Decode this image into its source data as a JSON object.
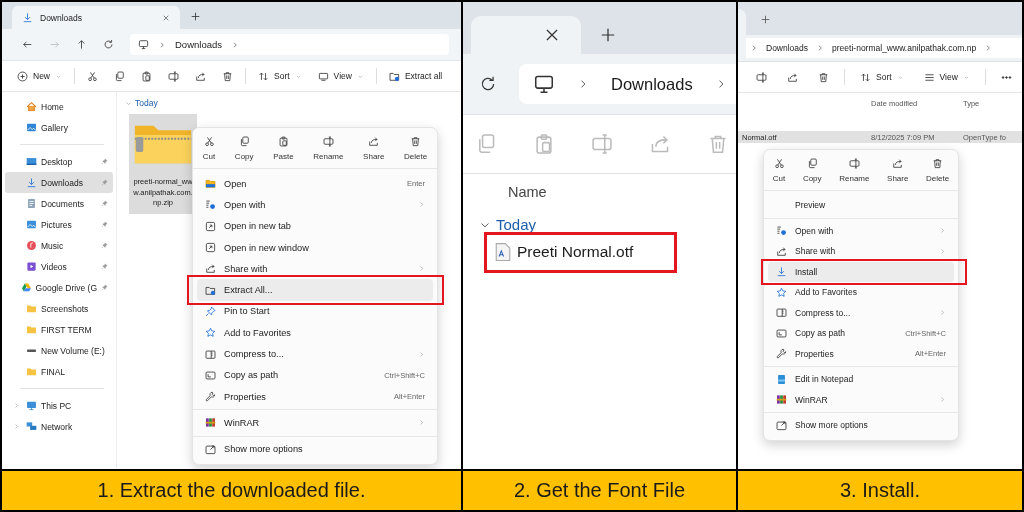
{
  "step1": {
    "tab": {
      "title": "Downloads"
    },
    "nav": [
      {
        "kind": "back",
        "disabled": false
      },
      {
        "kind": "forward",
        "disabled": true
      },
      {
        "kind": "up",
        "disabled": false
      },
      {
        "kind": "refresh",
        "disabled": false
      }
    ],
    "computer_root": true,
    "path": [
      "Downloads"
    ],
    "toolbar": [
      [
        {
          "kind": "new",
          "label": "New",
          "dropdown": true
        }
      ],
      [
        {
          "kind": "cut"
        },
        {
          "kind": "copy"
        },
        {
          "kind": "paste"
        },
        {
          "kind": "rename"
        },
        {
          "kind": "share"
        },
        {
          "kind": "delete"
        }
      ],
      [
        {
          "kind": "sort",
          "label": "Sort",
          "dropdown": true
        },
        {
          "kind": "view",
          "label": "View",
          "dropdown": true
        }
      ],
      [
        {
          "kind": "extract",
          "label": "Extract all",
          "dropdown": false
        }
      ]
    ],
    "sidebar": [
      {
        "items": [
          {
            "kind": "home",
            "label": "Home",
            "pinned": false,
            "selected": false,
            "expandable": false
          },
          {
            "kind": "gallery",
            "label": "Gallery",
            "pinned": false,
            "selected": false,
            "expandable": false
          }
        ]
      },
      {
        "items": [
          {
            "kind": "desktop",
            "label": "Desktop",
            "pinned": true,
            "selected": false,
            "expandable": false
          },
          {
            "kind": "downloads",
            "label": "Downloads",
            "pinned": true,
            "selected": true,
            "expandable": false
          },
          {
            "kind": "documents",
            "label": "Documents",
            "pinned": true,
            "selected": false,
            "expandable": false
          },
          {
            "kind": "pictures",
            "label": "Pictures",
            "pinned": true,
            "selected": false,
            "expandable": false
          },
          {
            "kind": "music",
            "label": "Music",
            "pinned": true,
            "selected": false,
            "expandable": false
          },
          {
            "kind": "videos",
            "label": "Videos",
            "pinned": true,
            "selected": false,
            "expandable": false
          },
          {
            "kind": "gdrive",
            "label": "Google Drive (G",
            "pinned": true,
            "selected": false,
            "expandable": false
          },
          {
            "kind": "folder",
            "label": "Screenshots",
            "pinned": false,
            "selected": false,
            "expandable": false
          },
          {
            "kind": "folder",
            "label": "FIRST TERM",
            "pinned": false,
            "selected": false,
            "expandable": false
          },
          {
            "kind": "drive",
            "label": "New Volume (E:)",
            "pinned": false,
            "selected": false,
            "expandable": false
          },
          {
            "kind": "folder",
            "label": "FINAL",
            "pinned": false,
            "selected": false,
            "expandable": false
          }
        ]
      },
      {
        "items": [
          {
            "kind": "pc",
            "label": "This PC",
            "pinned": false,
            "selected": false,
            "expandable": true
          },
          {
            "kind": "network",
            "label": "Network",
            "pinned": false,
            "selected": false,
            "expandable": true
          }
        ]
      }
    ],
    "section": "Today",
    "file": {
      "name": "preeti-normal_www.anilpathak.com.np.zip",
      "selected": true
    },
    "menu": {
      "actions": [
        {
          "kind": "cut",
          "label": "Cut"
        },
        {
          "kind": "copy",
          "label": "Copy"
        },
        {
          "kind": "paste",
          "label": "Paste"
        },
        {
          "kind": "rename",
          "label": "Rename"
        },
        {
          "kind": "share",
          "label": "Share"
        },
        {
          "kind": "delete",
          "label": "Delete"
        }
      ],
      "items": [
        {
          "kind": "open",
          "label": "Open",
          "shortcut": "Enter",
          "submenu": false,
          "highlighted": false
        },
        {
          "kind": "openwith",
          "label": "Open with",
          "submenu": true,
          "highlighted": false
        },
        {
          "kind": "tab",
          "label": "Open in new tab",
          "submenu": false,
          "highlighted": false
        },
        {
          "kind": "window",
          "label": "Open in new window",
          "submenu": false,
          "highlighted": false
        },
        {
          "kind": "share",
          "label": "Share with",
          "submenu": true,
          "highlighted": false
        },
        {
          "kind": "extract",
          "label": "Extract All...",
          "submenu": false,
          "highlighted": true
        },
        {
          "kind": "pin",
          "label": "Pin to Start",
          "submenu": false,
          "highlighted": false
        },
        {
          "kind": "star",
          "label": "Add to Favorites",
          "submenu": false,
          "highlighted": false
        },
        {
          "kind": "compress",
          "label": "Compress to...",
          "submenu": true,
          "highlighted": false
        },
        {
          "kind": "path",
          "label": "Copy as path",
          "shortcut": "Ctrl+Shift+C",
          "submenu": false,
          "highlighted": false
        },
        {
          "kind": "properties",
          "label": "Properties",
          "shortcut": "Alt+Enter",
          "submenu": false,
          "highlighted": false
        },
        {
          "kind": "separator"
        },
        {
          "kind": "winrar",
          "label": "WinRAR",
          "submenu": true,
          "highlighted": false
        },
        {
          "kind": "separator"
        },
        {
          "kind": "more",
          "label": "Show more options",
          "submenu": false,
          "highlighted": false
        }
      ]
    }
  },
  "step2": {
    "nav": [
      {
        "kind": "refresh"
      }
    ],
    "computer_root": true,
    "path": [
      "Downloads"
    ],
    "toolbar": [
      [
        {
          "kind": "copy",
          "disabled": true
        },
        {
          "kind": "paste",
          "disabled": true
        },
        {
          "kind": "rename",
          "disabled": true
        },
        {
          "kind": "share",
          "disabled": true
        },
        {
          "kind": "delete",
          "disabled": true
        }
      ]
    ],
    "column": "Name",
    "section": "Today",
    "file": {
      "name": "Preeti Normal.otf",
      "highlighted": true
    }
  },
  "step3": {
    "computer_root": false,
    "path": [
      "Downloads",
      "preeti-normal_www.anilpathak.com.np"
    ],
    "toolbar": [
      [
        {
          "kind": "rename"
        },
        {
          "kind": "share"
        },
        {
          "kind": "delete"
        }
      ],
      [
        {
          "kind": "sort",
          "label": "Sort",
          "dropdown": true
        },
        {
          "kind": "listview",
          "label": "View",
          "dropdown": true
        }
      ],
      [
        {
          "kind": "dots"
        }
      ]
    ],
    "columns": [
      "Date modified",
      "Type"
    ],
    "row": {
      "name": "Normal.otf",
      "date": "8/12/2025 7:09 PM",
      "type": "OpenType fo",
      "selected": true
    },
    "menu": {
      "actions": [
        {
          "kind": "cut",
          "label": "Cut"
        },
        {
          "kind": "copy",
          "label": "Copy"
        },
        {
          "kind": "rename",
          "label": "Rename"
        },
        {
          "kind": "share",
          "label": "Share"
        },
        {
          "kind": "delete",
          "label": "Delete"
        }
      ],
      "items": [
        {
          "kind": "preview",
          "label": "Preview",
          "submenu": false,
          "highlighted": false
        },
        {
          "kind": "separator"
        },
        {
          "kind": "openwith",
          "label": "Open with",
          "submenu": true,
          "highlighted": false
        },
        {
          "kind": "share",
          "label": "Share with",
          "submenu": true,
          "highlighted": false
        },
        {
          "kind": "install",
          "label": "Install",
          "submenu": false,
          "highlighted": true
        },
        {
          "kind": "star",
          "label": "Add to Favorites",
          "submenu": false,
          "highlighted": false
        },
        {
          "kind": "compress",
          "label": "Compress to...",
          "submenu": true,
          "highlighted": false
        },
        {
          "kind": "path",
          "label": "Copy as path",
          "shortcut": "Ctrl+Shift+C",
          "submenu": false,
          "highlighted": false
        },
        {
          "kind": "properties",
          "label": "Properties",
          "shortcut": "Alt+Enter",
          "submenu": false,
          "highlighted": false
        },
        {
          "kind": "separator"
        },
        {
          "kind": "notepad",
          "label": "Edit in Notepad",
          "submenu": false,
          "highlighted": false
        },
        {
          "kind": "winrar",
          "label": "WinRAR",
          "submenu": true,
          "highlighted": false
        },
        {
          "kind": "separator"
        },
        {
          "kind": "more",
          "label": "Show more options",
          "submenu": false,
          "highlighted": false
        }
      ]
    }
  },
  "captions": [
    "1. Extract the downloaded file.",
    "2. Get the Font File",
    "3. Install."
  ]
}
